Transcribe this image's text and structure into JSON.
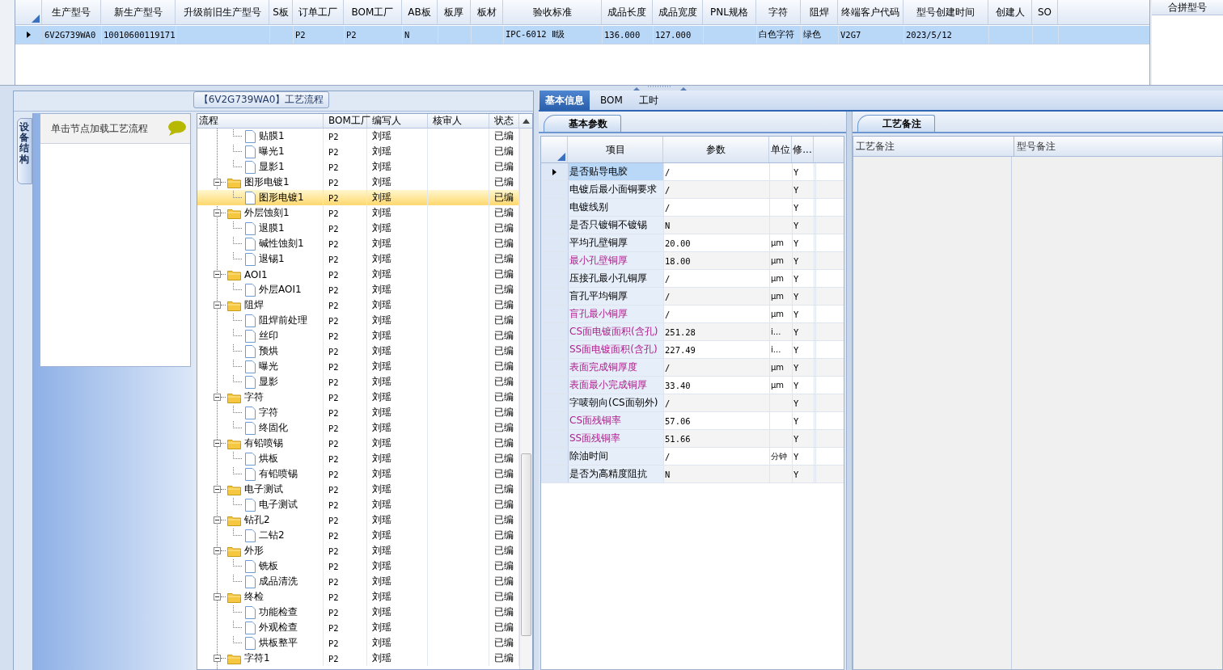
{
  "main_grid": {
    "columns": [
      "生产型号",
      "新生产型号",
      "升级前旧生产型号",
      "S板",
      "订单工厂",
      "BOM工厂",
      "AB板",
      "板厚",
      "板材",
      "验收标准",
      "成品长度",
      "成品宽度",
      "PNL规格",
      "字符",
      "阻焊",
      "终端客户代码",
      "型号创建时间",
      "创建人",
      "SO"
    ],
    "rows": [
      {
        "selected": true,
        "cells": [
          "6V2G739WA0",
          "10010600119171",
          null,
          null,
          "P2",
          "P2",
          "N",
          null,
          null,
          "IPC-6012 Ⅱ级",
          "136.000",
          "127.000",
          null,
          "白色字符",
          "绿色",
          "V2G7",
          "2023/5/12",
          null,
          null
        ]
      }
    ]
  },
  "merge_panel": {
    "title": "合拼型号"
  },
  "flow_panel": {
    "title": "【6V2G739WA0】工艺流程",
    "side_tab": "设备结构",
    "hint": "单击节点加载工艺流程",
    "tree": {
      "columns": [
        "流程",
        "BOM工厂",
        "编写人",
        "核审人",
        "状态"
      ],
      "rows": [
        {
          "kind": "step",
          "name": "贴膜1",
          "factory": "P2",
          "writer": "刘瑶",
          "status": "已编",
          "selected": false
        },
        {
          "kind": "step",
          "name": "曝光1",
          "factory": "P2",
          "writer": "刘瑶",
          "status": "已编",
          "selected": false
        },
        {
          "kind": "step",
          "name": "显影1",
          "factory": "P2",
          "writer": "刘瑶",
          "status": "已编",
          "selected": false
        },
        {
          "kind": "group",
          "name": "图形电镀1",
          "factory": "P2",
          "writer": "刘瑶",
          "status": "已编",
          "selected": false,
          "expanded": true,
          "children": [
            {
              "kind": "step",
              "name": "图形电镀1",
              "factory": "P2",
              "writer": "刘瑶",
              "status": "已编",
              "selected": true
            }
          ]
        },
        {
          "kind": "group",
          "name": "外层蚀刻1",
          "factory": "P2",
          "writer": "刘瑶",
          "status": "已编",
          "selected": false,
          "expanded": true,
          "children": [
            {
              "kind": "step",
              "name": "退膜1",
              "factory": "P2",
              "writer": "刘瑶",
              "status": "已编",
              "selected": false
            },
            {
              "kind": "step",
              "name": "碱性蚀刻1",
              "factory": "P2",
              "writer": "刘瑶",
              "status": "已编",
              "selected": false
            },
            {
              "kind": "step",
              "name": "退锡1",
              "factory": "P2",
              "writer": "刘瑶",
              "status": "已编",
              "selected": false
            }
          ]
        },
        {
          "kind": "group",
          "name": "AOI1",
          "factory": "P2",
          "writer": "刘瑶",
          "status": "已编",
          "selected": false,
          "expanded": true,
          "children": [
            {
              "kind": "step",
              "name": "外层AOI1",
              "factory": "P2",
              "writer": "刘瑶",
              "status": "已编",
              "selected": false
            }
          ]
        },
        {
          "kind": "group",
          "name": "阻焊",
          "factory": "P2",
          "writer": "刘瑶",
          "status": "已编",
          "selected": false,
          "expanded": true,
          "children": [
            {
              "kind": "step",
              "name": "阻焊前处理",
              "factory": "P2",
              "writer": "刘瑶",
              "status": "已编",
              "selected": false
            },
            {
              "kind": "step",
              "name": "丝印",
              "factory": "P2",
              "writer": "刘瑶",
              "status": "已编",
              "selected": false
            },
            {
              "kind": "step",
              "name": "预烘",
              "factory": "P2",
              "writer": "刘瑶",
              "status": "已编",
              "selected": false
            },
            {
              "kind": "step",
              "name": "曝光",
              "factory": "P2",
              "writer": "刘瑶",
              "status": "已编",
              "selected": false
            },
            {
              "kind": "step",
              "name": "显影",
              "factory": "P2",
              "writer": "刘瑶",
              "status": "已编",
              "selected": false
            }
          ]
        },
        {
          "kind": "group",
          "name": "字符",
          "factory": "P2",
          "writer": "刘瑶",
          "status": "已编",
          "selected": false,
          "expanded": true,
          "children": [
            {
              "kind": "step",
              "name": "字符",
              "factory": "P2",
              "writer": "刘瑶",
              "status": "已编",
              "selected": false
            },
            {
              "kind": "step",
              "name": "终固化",
              "factory": "P2",
              "writer": "刘瑶",
              "status": "已编",
              "selected": false
            }
          ]
        },
        {
          "kind": "group",
          "name": "有铅喷锡",
          "factory": "P2",
          "writer": "刘瑶",
          "status": "已编",
          "selected": false,
          "expanded": true,
          "children": [
            {
              "kind": "step",
              "name": "烘板",
              "factory": "P2",
              "writer": "刘瑶",
              "status": "已编",
              "selected": false
            },
            {
              "kind": "step",
              "name": "有铅喷锡",
              "factory": "P2",
              "writer": "刘瑶",
              "status": "已编",
              "selected": false
            }
          ]
        },
        {
          "kind": "group",
          "name": "电子测试",
          "factory": "P2",
          "writer": "刘瑶",
          "status": "已编",
          "selected": false,
          "expanded": true,
          "children": [
            {
              "kind": "step",
              "name": "电子测试",
              "factory": "P2",
              "writer": "刘瑶",
              "status": "已编",
              "selected": false
            }
          ]
        },
        {
          "kind": "group",
          "name": "钻孔2",
          "factory": "P2",
          "writer": "刘瑶",
          "status": "已编",
          "selected": false,
          "expanded": true,
          "children": [
            {
              "kind": "step",
              "name": "二钻2",
              "factory": "P2",
              "writer": "刘瑶",
              "status": "已编",
              "selected": false
            }
          ]
        },
        {
          "kind": "group",
          "name": "外形",
          "factory": "P2",
          "writer": "刘瑶",
          "status": "已编",
          "selected": false,
          "expanded": true,
          "children": [
            {
              "kind": "step",
              "name": "铣板",
              "factory": "P2",
              "writer": "刘瑶",
              "status": "已编",
              "selected": false
            },
            {
              "kind": "step",
              "name": "成品清洗",
              "factory": "P2",
              "writer": "刘瑶",
              "status": "已编",
              "selected": false
            }
          ]
        },
        {
          "kind": "group",
          "name": "终检",
          "factory": "P2",
          "writer": "刘瑶",
          "status": "已编",
          "selected": false,
          "expanded": true,
          "children": [
            {
              "kind": "step",
              "name": "功能检查",
              "factory": "P2",
              "writer": "刘瑶",
              "status": "已编",
              "selected": false
            },
            {
              "kind": "step",
              "name": "外观检查",
              "factory": "P2",
              "writer": "刘瑶",
              "status": "已编",
              "selected": false
            },
            {
              "kind": "step",
              "name": "烘板整平",
              "factory": "P2",
              "writer": "刘瑶",
              "status": "已编",
              "selected": false
            }
          ]
        },
        {
          "kind": "group",
          "name": "字符1",
          "factory": "P2",
          "writer": "刘瑶",
          "status": "已编",
          "selected": false,
          "expanded": true
        }
      ]
    }
  },
  "detail_tabs": [
    {
      "label": "基本信息",
      "selected": true
    },
    {
      "label": "BOM",
      "selected": false
    },
    {
      "label": "工时",
      "selected": false
    }
  ],
  "params": {
    "tab": "基本参数",
    "columns": [
      "项目",
      "参数",
      "单位",
      "修..."
    ],
    "rows": [
      {
        "item": "是否贴导电胶",
        "value": "/",
        "modifiable": "Y",
        "highlighted": false,
        "selected": true
      },
      {
        "item": "电镀后最小面铜要求",
        "value": "/",
        "modifiable": "Y",
        "highlighted": false,
        "selected": false
      },
      {
        "item": "电镀线别",
        "value": "/",
        "modifiable": "Y",
        "highlighted": false,
        "selected": false
      },
      {
        "item": "是否只镀铜不镀锡",
        "value": "N",
        "modifiable": "Y",
        "highlighted": false,
        "selected": false
      },
      {
        "item": "平均孔壁铜厚",
        "value": "20.00",
        "unit": "μm",
        "modifiable": "Y",
        "highlighted": false,
        "selected": false
      },
      {
        "item": "最小孔壁铜厚",
        "value": "18.00",
        "unit": "μm",
        "modifiable": "Y",
        "highlighted": true,
        "selected": false
      },
      {
        "item": "压接孔最小孔铜厚",
        "value": "/",
        "unit": "μm",
        "modifiable": "Y",
        "highlighted": false,
        "selected": false
      },
      {
        "item": "盲孔平均铜厚",
        "value": "/",
        "unit": "μm",
        "modifiable": "Y",
        "highlighted": false,
        "selected": false
      },
      {
        "item": "盲孔最小铜厚",
        "value": "/",
        "unit": "μm",
        "modifiable": "Y",
        "highlighted": true,
        "selected": false
      },
      {
        "item": "CS面电镀面积(含孔)",
        "value": "251.28",
        "unit": "i...",
        "modifiable": "Y",
        "highlighted": true,
        "selected": false
      },
      {
        "item": "SS面电镀面积(含孔)",
        "value": "227.49",
        "unit": "i...",
        "modifiable": "Y",
        "highlighted": true,
        "selected": false
      },
      {
        "item": "表面完成铜厚度",
        "value": "/",
        "unit": "μm",
        "modifiable": "Y",
        "highlighted": true,
        "selected": false
      },
      {
        "item": "表面最小完成铜厚",
        "value": "33.40",
        "unit": "μm",
        "modifiable": "Y",
        "highlighted": true,
        "selected": false
      },
      {
        "item": "字唛朝向(CS面朝外)",
        "value": "/",
        "modifiable": "Y",
        "highlighted": false,
        "selected": false
      },
      {
        "item": "CS面残铜率",
        "value": "57.06",
        "modifiable": "Y",
        "highlighted": true,
        "selected": false
      },
      {
        "item": "SS面残铜率",
        "value": "51.66",
        "modifiable": "Y",
        "highlighted": true,
        "selected": false
      },
      {
        "item": "除油时间",
        "value": "/",
        "unit": "分钟",
        "modifiable": "Y",
        "highlighted": false,
        "selected": false
      },
      {
        "item": "是否为高精度阻抗",
        "value": "N",
        "modifiable": "Y",
        "highlighted": false,
        "selected": false
      }
    ]
  },
  "notes": {
    "tab": "工艺备注",
    "columns": [
      "工艺备注",
      "型号备注"
    ]
  }
}
